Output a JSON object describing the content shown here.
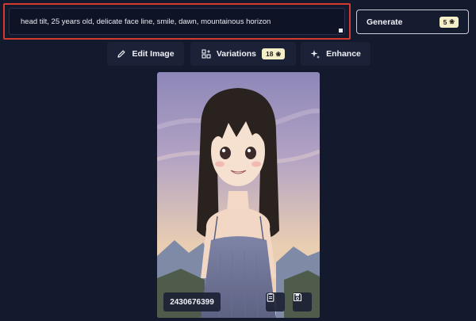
{
  "prompt": {
    "text": "head tilt, 25 years old, delicate face line, smile, dawn, mountainous horizon"
  },
  "generate": {
    "label": "Generate",
    "cost": "5",
    "cost_icon": "credit-icon"
  },
  "toolbar": {
    "edit_label": "Edit Image",
    "edit_icon": "pencil-icon",
    "variations_label": "Variations",
    "variations_icon": "variations-icon",
    "variations_cost": "18",
    "enhance_label": "Enhance",
    "enhance_icon": "sparkle-icon"
  },
  "image": {
    "seed": "2430676399",
    "copy_icon": "clipboard-icon",
    "save_icon": "save-icon"
  },
  "colors": {
    "background": "#141a2e",
    "highlight": "#d23b2e",
    "badge": "#f4efc8"
  }
}
